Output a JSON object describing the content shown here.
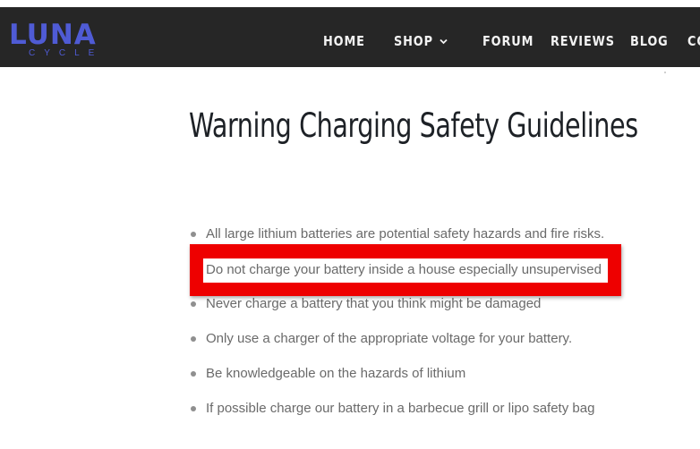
{
  "brand": {
    "name": "LUNA",
    "sub": "CYCLE",
    "color": "#4f5bd5"
  },
  "nav": {
    "items": [
      {
        "label": "HOME"
      },
      {
        "label": "SHOP",
        "icon": "chevron-down-icon"
      },
      {
        "label": "FORUM"
      },
      {
        "label": "REVIEWS"
      },
      {
        "label": "BLOG"
      },
      {
        "label": "CO"
      }
    ]
  },
  "page": {
    "title": "Warning Charging Safety Guidelines",
    "bullets": [
      "All  large lithium batteries are potential  safety hazards and fire risks.",
      "Do not charge your battery inside a house especially unsupervised",
      "Never charge a battery that you think might be damaged",
      "Only use a charger of the appropriate voltage for your battery.",
      "Be knowledgeable on the hazards of lithium",
      "If possible charge our battery in a barbecue grill or lipo safety bag"
    ],
    "highlight_color": "#ee0000"
  }
}
